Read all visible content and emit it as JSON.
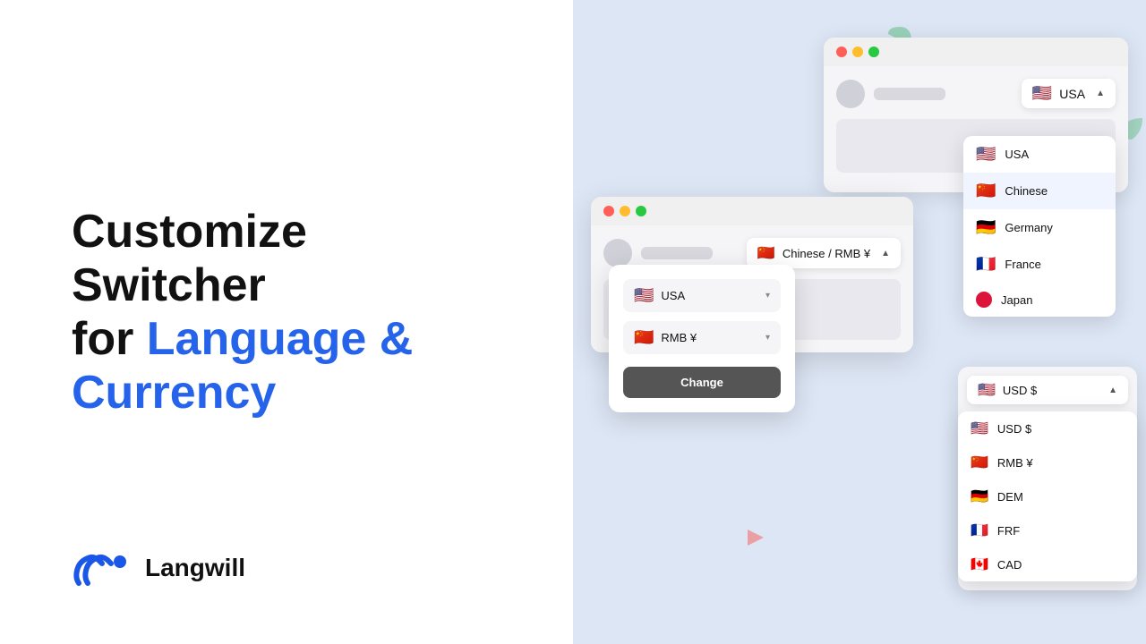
{
  "left": {
    "headline_line1": "Customize Switcher",
    "headline_line2": "for ",
    "headline_highlight": "Language &",
    "headline_line3": "Currency",
    "logo_text": "Langwill"
  },
  "right": {
    "window1": {
      "trigger_flag": "🇺🇸",
      "trigger_label": "USA",
      "dropdown_items": [
        {
          "flag": "🇺🇸",
          "label": "USA",
          "selected": false
        },
        {
          "flag": "🇨🇳",
          "label": "Chinese",
          "selected": true
        },
        {
          "flag": "🇩🇪",
          "label": "Germany",
          "selected": false
        },
        {
          "flag": "🇫🇷",
          "label": "France",
          "selected": false
        },
        {
          "flag": "japan",
          "label": "Japan",
          "selected": false
        }
      ]
    },
    "window2": {
      "trigger_flag": "🇨🇳",
      "trigger_label": "Chinese / RMB ¥",
      "lang_select_flag": "🇺🇸",
      "lang_select_label": "USA",
      "currency_select_flag": "🇨🇳",
      "currency_select_label": "RMB ¥",
      "change_button": "Change"
    },
    "window3": {
      "trigger_flag": "🇺🇸",
      "trigger_label": "USD $",
      "currency_items": [
        {
          "flag": "🇺🇸",
          "label": "USD $"
        },
        {
          "flag": "🇨🇳",
          "label": "RMB ¥"
        },
        {
          "flag": "🇩🇪",
          "label": "DEM"
        },
        {
          "flag": "🇫🇷",
          "label": "FRF"
        },
        {
          "flag": "🇨🇦",
          "label": "CAD"
        }
      ]
    }
  }
}
